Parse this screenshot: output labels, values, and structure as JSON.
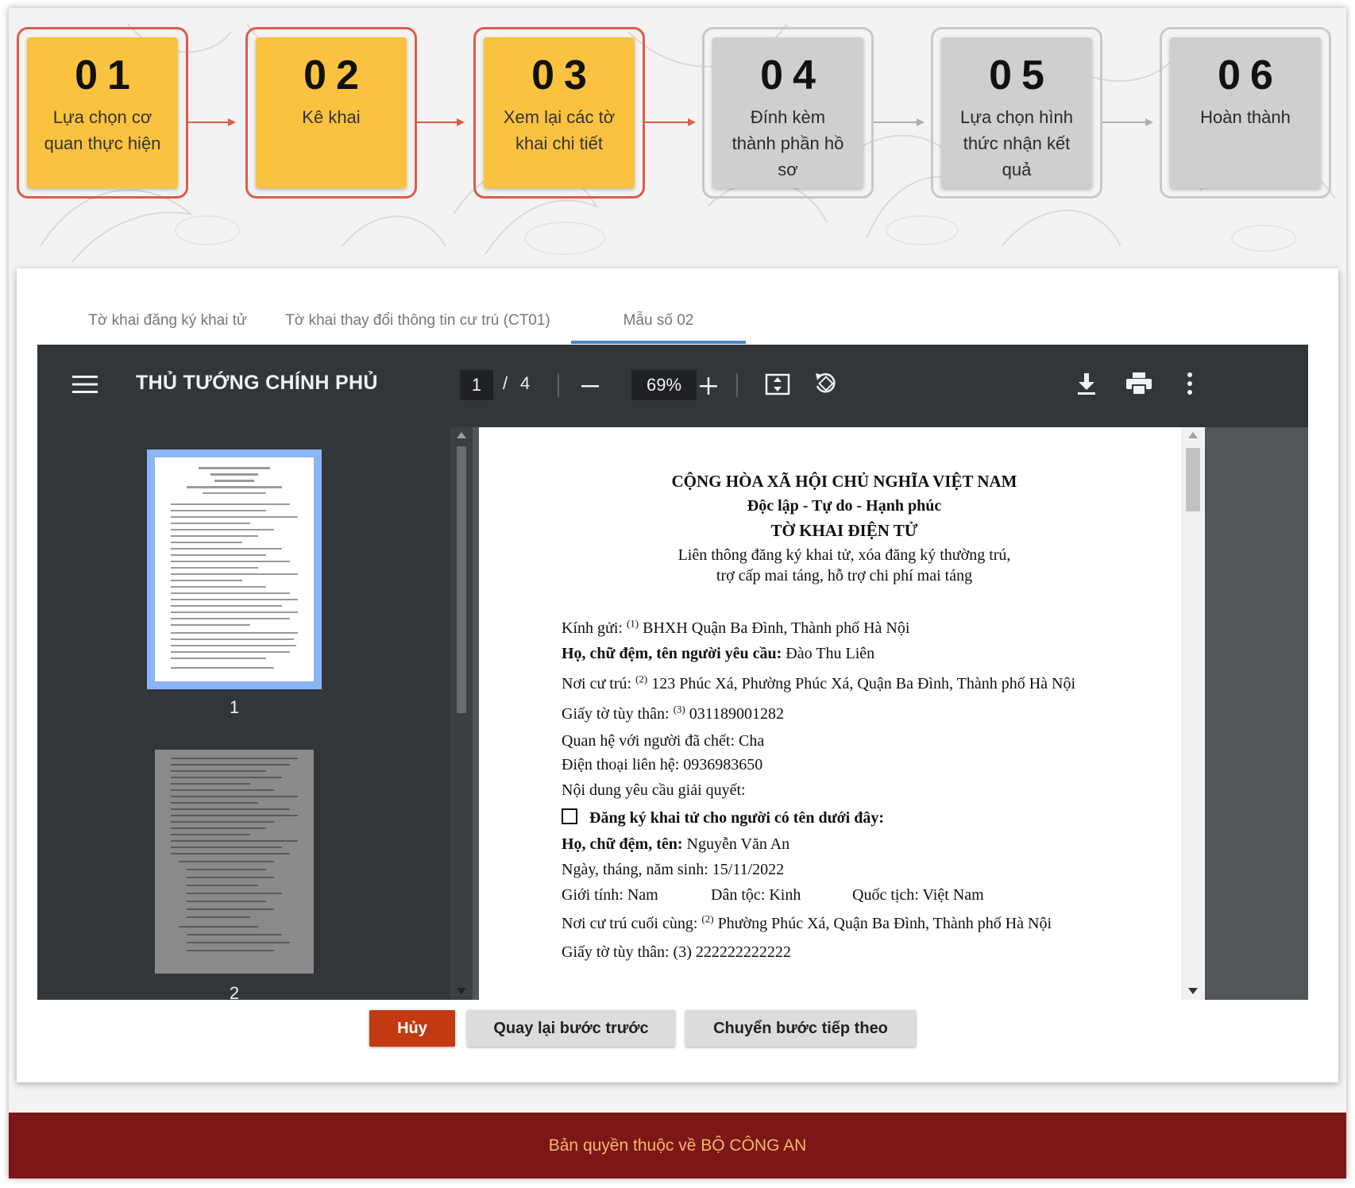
{
  "steps": [
    {
      "num": "01",
      "label": "Lựa chọn cơ quan thực hiện",
      "state": "completed"
    },
    {
      "num": "02",
      "label": "Kê khai",
      "state": "completed"
    },
    {
      "num": "03",
      "label": "Xem lại các tờ khai chi tiết",
      "state": "current"
    },
    {
      "num": "04",
      "label": "Đính kèm thành phần hồ sơ",
      "state": "pending"
    },
    {
      "num": "05",
      "label": "Lựa chọn hình thức nhận kết quả",
      "state": "pending"
    },
    {
      "num": "06",
      "label": "Hoàn thành",
      "state": "pending"
    }
  ],
  "tabs": [
    {
      "label": "Tờ khai đăng ký khai tử",
      "active": false
    },
    {
      "label": "Tờ khai thay đổi thông tin cư trú (CT01)",
      "active": false
    },
    {
      "label": "Mẫu số 02",
      "active": true
    }
  ],
  "viewer": {
    "title": "THỦ TƯỚNG CHÍNH PHỦ",
    "page_current": "1",
    "page_separator": "/",
    "page_total": "4",
    "zoom": "69%",
    "icons": [
      "menu-icon",
      "zoom-out-icon",
      "zoom-in-icon",
      "fit-page-icon",
      "rotate-icon",
      "download-icon",
      "print-icon",
      "more-icon"
    ],
    "thumbnails": [
      {
        "label": "1",
        "selected": true
      },
      {
        "label": "2",
        "selected": false
      }
    ]
  },
  "document": {
    "header1": "CỘNG HÒA XÃ HỘI CHỦ NGHĨA VIỆT NAM",
    "header2": "Độc lập - Tự do - Hạnh phúc",
    "title": "TỜ KHAI ĐIỆN TỬ",
    "subtitle1": "Liên thông đăng ký khai tử, xóa đăng ký thường trú,",
    "subtitle2": "trợ cấp mai táng, hỗ trợ chi phí mai táng",
    "recipient_label": "Kính gửi:",
    "recipient_sup": "(1)",
    "recipient_value": "BHXH Quận Ba Đình, Thành phố Hà Nội",
    "requester_label": "Họ, chữ đệm, tên người yêu cầu:",
    "requester_value": "Đào Thu Liên",
    "residence_label": "Nơi cư trú:",
    "residence_sup": "(2)",
    "residence_value": "123 Phúc Xá, Phường Phúc Xá, Quận Ba Đình, Thành phố Hà Nội",
    "id_label": "Giấy tờ tùy thân:",
    "id_sup": "(3)",
    "id_value": "031189001282",
    "relation_label": "Quan hệ với người đã chết:",
    "relation_value": "Cha",
    "phone_label": "Điện thoại liên hệ:",
    "phone_value": "0936983650",
    "request_content_label": "Nội dung yêu cầu giải quyết:",
    "checkbox_label": "Đăng ký khai tử cho người có tên dưới đây:",
    "deceased_name_label": "Họ, chữ đệm, tên:",
    "deceased_name_value": "Nguyễn Văn An",
    "dob_label": "Ngày, tháng, năm sinh:",
    "dob_value": "15/11/2022",
    "gender_label": "Giới tính:",
    "gender_value": "Nam",
    "ethnicity_label": "Dân tộc:",
    "ethnicity_value": "Kinh",
    "nationality_label": "Quốc tịch:",
    "nationality_value": "Việt Nam",
    "last_residence_label": "Nơi cư trú cuối cùng:",
    "last_residence_sup": "(2)",
    "last_residence_value": "Phường Phúc Xá, Quận Ba Đình, Thành phố Hà Nội",
    "partial_line": "Giấy tờ tùy thân: (3) 222222222222"
  },
  "buttons": {
    "cancel": "Hủy",
    "back": "Quay lại bước trước",
    "next": "Chuyển bước tiếp theo"
  },
  "footer": "Bản quyền thuộc về BỘ CÔNG AN",
  "colors": {
    "step_active": "#fbc23f",
    "step_inactive": "#cfcfcf",
    "step_border_active": "#e05a4a",
    "cancel_button": "#c33a12",
    "footer_bg": "#7d1616",
    "footer_text": "#f2b96a",
    "tab_indicator": "#4a86c8"
  }
}
